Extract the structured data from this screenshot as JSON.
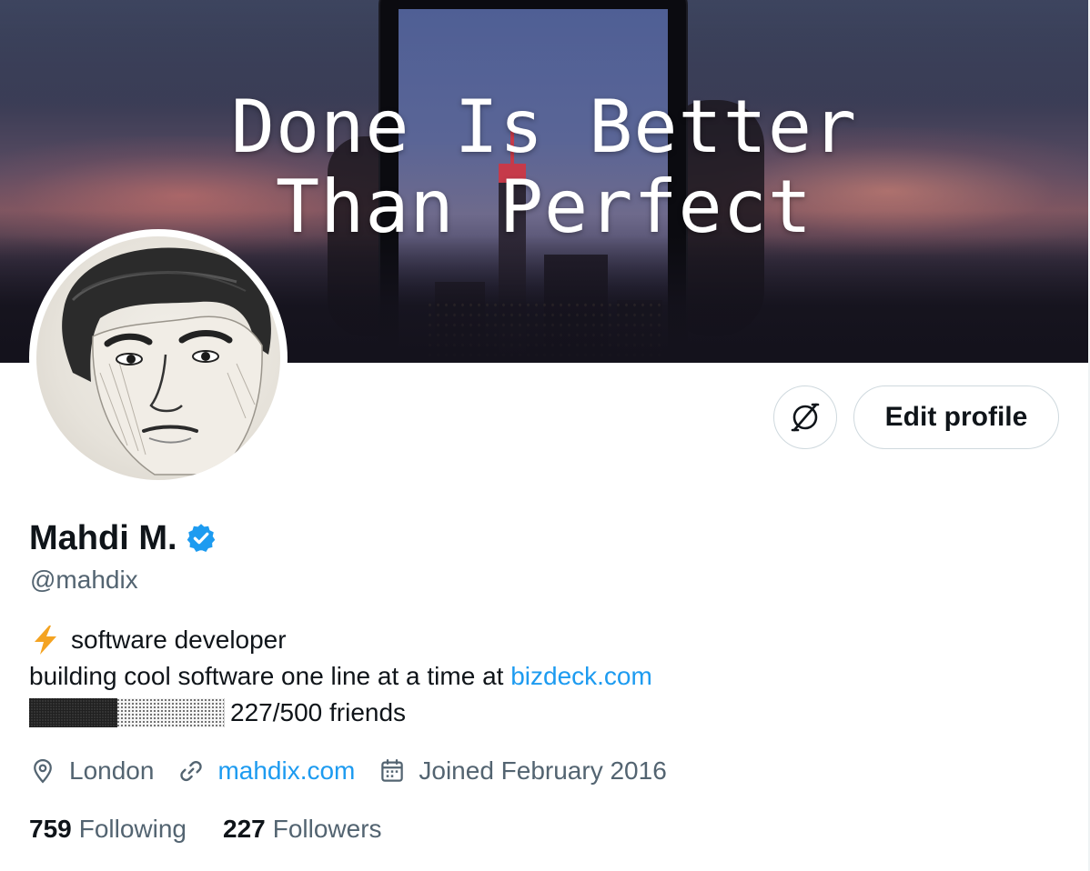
{
  "banner": {
    "line1": "Done Is Better",
    "line2": "Than Perfect"
  },
  "buttons": {
    "edit_profile": "Edit profile",
    "icon_button_icon": "circle-slash-icon"
  },
  "profile": {
    "name": "Mahdi M.",
    "verified": true,
    "handle": "@mahdix"
  },
  "bio": {
    "line1": "software developer",
    "line1_emoji": "lightning-bolt-icon",
    "line2_prefix": "building cool software one line at a time at ",
    "line2_link": "bizdeck.com",
    "progress_fraction": 0.454,
    "line3_text": "227/500 friends"
  },
  "meta": {
    "location": "London",
    "website": "mahdix.com",
    "joined": "Joined February 2016"
  },
  "stats": {
    "following_count": "759",
    "following_label": "Following",
    "followers_count": "227",
    "followers_label": "Followers"
  },
  "colors": {
    "link": "#1d9bf0",
    "verified": "#1d9bf0",
    "secondary_text": "#536471",
    "primary_text": "#0f1419"
  }
}
